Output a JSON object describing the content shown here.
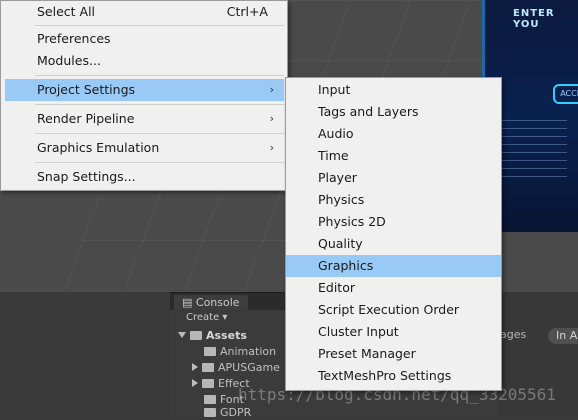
{
  "main_menu": {
    "items": [
      {
        "label": "Select All",
        "shortcut": "Ctrl+A"
      },
      {
        "label": "Preferences"
      },
      {
        "label": "Modules..."
      },
      {
        "label": "Project Settings"
      },
      {
        "label": "Render Pipeline"
      },
      {
        "label": "Graphics Emulation"
      },
      {
        "label": "Snap Settings..."
      }
    ],
    "submenu_arrow": "›"
  },
  "submenu": {
    "items": [
      "Input",
      "Tags and Layers",
      "Audio",
      "Time",
      "Player",
      "Physics",
      "Physics 2D",
      "Quality",
      "Graphics",
      "Editor",
      "Script Execution Order",
      "Cluster Input",
      "Preset Manager",
      "TextMeshPro Settings"
    ],
    "selected": "Graphics"
  },
  "editor": {
    "console_tab": "Console",
    "create_label": "Create",
    "assets_label": "Assets",
    "folders": [
      "Animation",
      "APUSGame",
      "Effect",
      "Font",
      "GDPR"
    ],
    "right_label": "ages",
    "right_pill": "In A"
  },
  "game_view": {
    "title": "ENTER YOU",
    "button": "ACCE"
  },
  "watermark": "https://blog.csdn.net/qq_33205561",
  "colors": {
    "menu_bg": "#f0f0f0",
    "highlight": "#99c9f5",
    "editor_bg": "#4a4a4a"
  }
}
